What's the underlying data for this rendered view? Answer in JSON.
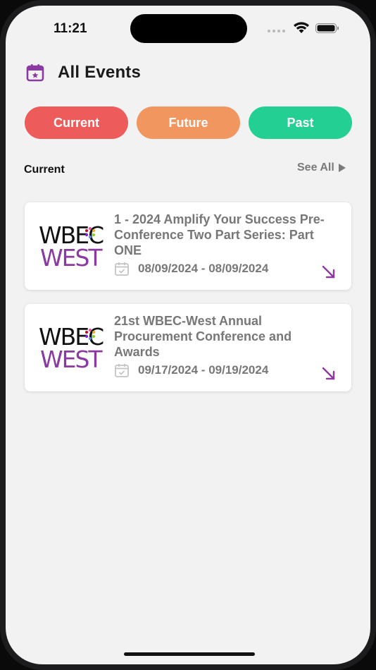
{
  "status_bar": {
    "time": "11:21"
  },
  "header": {
    "icon": "calendar-star-icon",
    "title": "All Events"
  },
  "tabs": [
    {
      "label": "Current",
      "color": "#ee5b5b"
    },
    {
      "label": "Future",
      "color": "#f2965f"
    },
    {
      "label": "Past",
      "color": "#24cf93"
    }
  ],
  "section": {
    "title": "Current",
    "see_all_label": "See All"
  },
  "events": [
    {
      "logo_top": "WBEC",
      "logo_bottom": "WEST",
      "title": "1 - 2024 Amplify Your Success Pre-Conference Two Part Series: Part ONE",
      "date_range": "08/09/2024 - 08/09/2024"
    },
    {
      "logo_top": "WBEC",
      "logo_bottom": "WEST",
      "title": "21st WBEC-West Annual Procurement Conference and Awards",
      "date_range": "09/17/2024 - 09/19/2024"
    }
  ],
  "colors": {
    "accent_purple": "#8a3aa0",
    "background": "#f2f2f2"
  }
}
